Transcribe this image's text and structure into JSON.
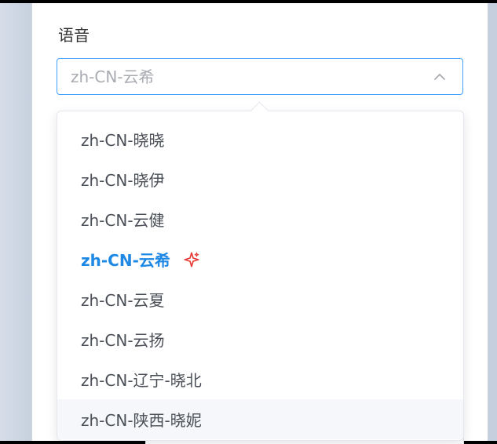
{
  "form": {
    "label": "语音",
    "select": {
      "value": "zh-CN-云希"
    }
  },
  "dropdown": {
    "options": [
      {
        "label": "zh-CN-晓晓"
      },
      {
        "label": "zh-CN-晓伊"
      },
      {
        "label": "zh-CN-云健"
      },
      {
        "label": "zh-CN-云希"
      },
      {
        "label": "zh-CN-云夏"
      },
      {
        "label": "zh-CN-云扬"
      },
      {
        "label": "zh-CN-辽宁-晓北"
      },
      {
        "label": "zh-CN-陕西-晓妮"
      }
    ],
    "selected_index": 3,
    "hover_index": 7
  },
  "icons": {
    "chevron": "chevron-up-icon",
    "spark": "sparkle-icon"
  },
  "colors": {
    "accent": "#409eff",
    "selected_text": "#1e88e5",
    "spark": "#e53935"
  }
}
